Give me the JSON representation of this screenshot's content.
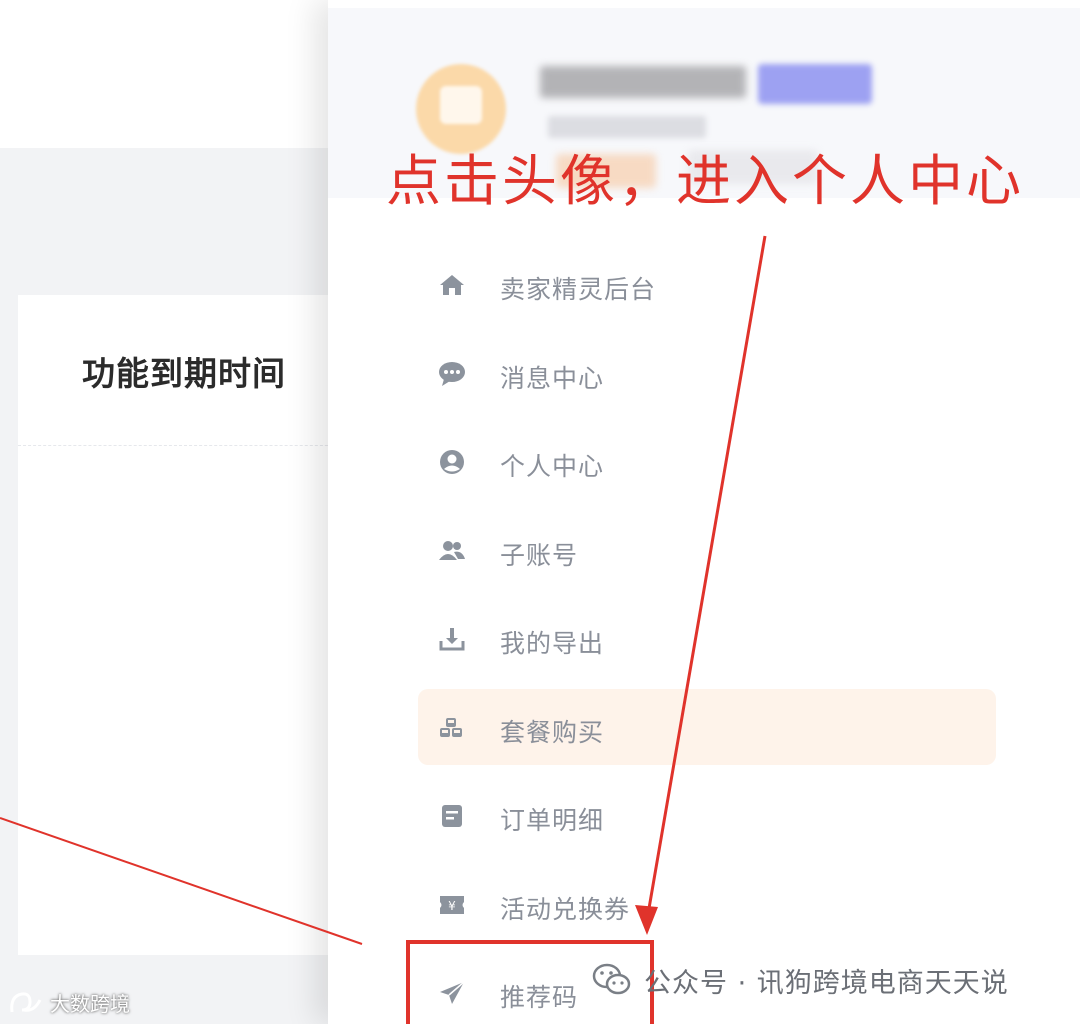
{
  "background": {
    "card_title": "功能到期时间"
  },
  "drawer": {
    "menu": [
      {
        "label": "卖家精灵后台",
        "icon": "home-icon",
        "active": false
      },
      {
        "label": "消息中心",
        "icon": "chat-bubble-icon",
        "active": false
      },
      {
        "label": "个人中心",
        "icon": "user-circle-icon",
        "active": false
      },
      {
        "label": "子账号",
        "icon": "users-icon",
        "active": false
      },
      {
        "label": "我的导出",
        "icon": "download-icon",
        "active": false
      },
      {
        "label": "套餐购买",
        "icon": "cubes-icon",
        "active": true
      },
      {
        "label": "订单明细",
        "icon": "order-list-icon",
        "active": false
      },
      {
        "label": "活动兑换券",
        "icon": "ticket-yen-icon",
        "active": false
      },
      {
        "label": "推荐码",
        "icon": "paper-plane-icon",
        "active": false
      }
    ]
  },
  "annotation": {
    "text": "点击头像，进入个人中心",
    "color": "#e0332b"
  },
  "watermark": {
    "text": "公众号 · 讯狗跨境电商天天说",
    "icon": "wechat-icon",
    "brand": "大数跨境",
    "brand_icon": "brand-logo-icon"
  },
  "colors": {
    "active_bg": "#fef3ea",
    "menu_text": "#8a8f99",
    "menu_icon": "#8c939d"
  }
}
